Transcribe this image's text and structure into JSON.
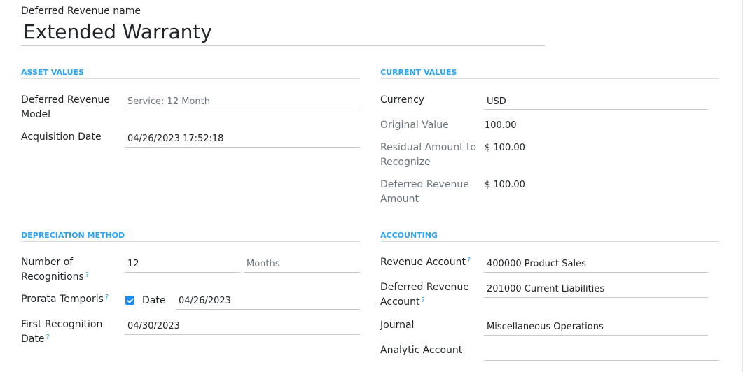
{
  "name_label": "Deferred Revenue name",
  "name_value": "Extended Warranty",
  "asset_values": {
    "title": "ASSET VALUES",
    "model_label_line1": "Deferred Revenue",
    "model_label_line2": "Model",
    "model_placeholder": "Service: 12 Month",
    "acq_label": "Acquisition Date",
    "acq_value": "04/26/2023 17:52:18"
  },
  "current_values": {
    "title": "CURRENT VALUES",
    "currency_label": "Currency",
    "currency_value": "USD",
    "original_label": "Original Value",
    "original_value": "100.00",
    "residual_label_line1": "Residual Amount to",
    "residual_label_line2": "Recognize",
    "residual_value": "$ 100.00",
    "deferred_amount_label_line1": "Deferred Revenue",
    "deferred_amount_label_line2": "Amount",
    "deferred_amount_value": "$ 100.00"
  },
  "depreciation": {
    "title": "DEPRECIATION METHOD",
    "number_label_line1": "Number of",
    "number_label_line2": "Recognitions",
    "number_value": "12",
    "period_value": "Months",
    "prorata_label": "Prorata Temporis",
    "prorata_checked": true,
    "date_label": "Date",
    "date_value": "04/26/2023",
    "first_label_line1": "First Recognition",
    "first_label_line2": "Date",
    "first_value": "04/30/2023",
    "help_mark": "?"
  },
  "accounting": {
    "title": "ACCOUNTING",
    "revenue_label": "Revenue Account",
    "revenue_value": "400000 Product Sales",
    "deferred_label_line1": "Deferred Revenue",
    "deferred_label_line2": "Account",
    "deferred_value": "201000 Current Liabilities",
    "journal_label": "Journal",
    "journal_value": "Miscellaneous Operations",
    "analytic_label": "Analytic Account",
    "analytic_value": ""
  },
  "colors": {
    "accent": "#2ea3f2",
    "checkbox": "#1a8cf0",
    "muted": "#6c757d"
  }
}
